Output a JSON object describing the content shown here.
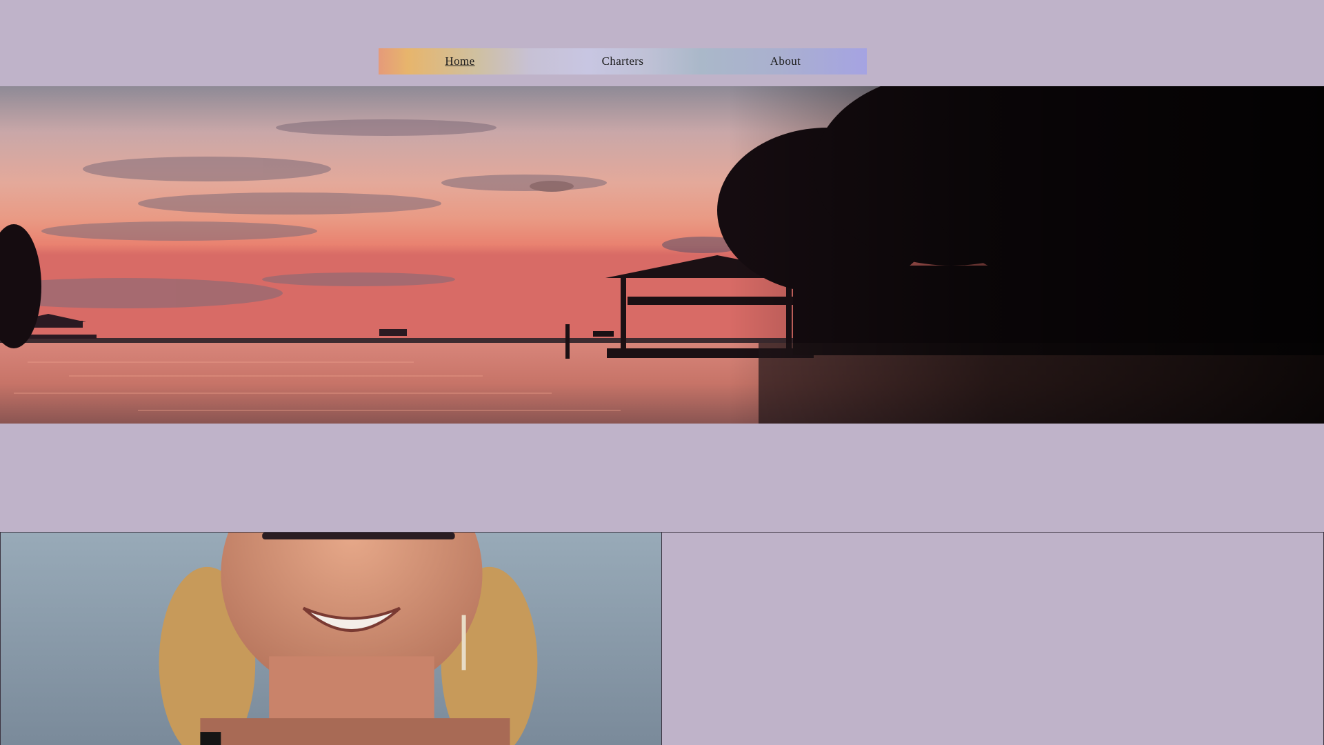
{
  "nav": {
    "items": [
      {
        "label": "Home",
        "active": true
      },
      {
        "label": "Charters",
        "active": false
      },
      {
        "label": "About",
        "active": false
      }
    ]
  },
  "hero": {
    "image": "sunset-over-river-with-boathouse-and-oak-trees"
  },
  "feature": {
    "image": "smiling-woman-with-blonde-pigtails-on-water"
  },
  "colors": {
    "page_background": "#bfb3c9",
    "border": "#3b3340"
  }
}
